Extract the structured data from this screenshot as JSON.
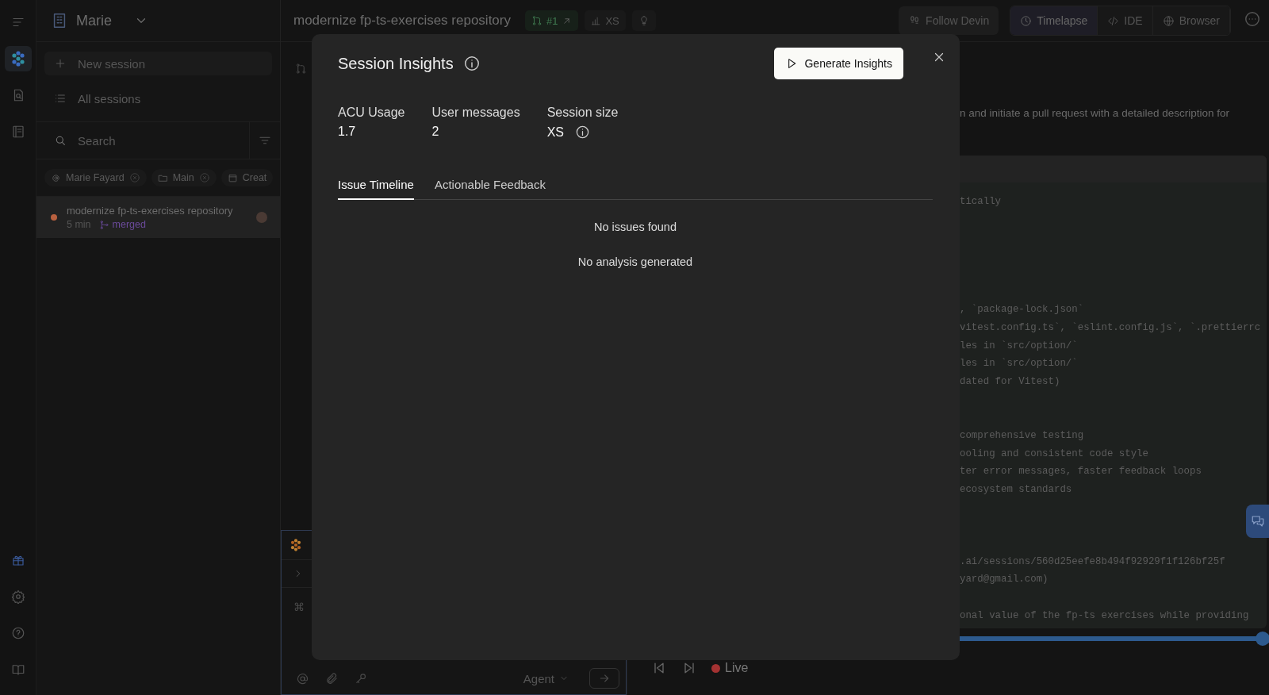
{
  "rail": {
    "top_icons": [
      {
        "kind": "menu",
        "selected": false
      },
      {
        "kind": "logo",
        "selected": true
      },
      {
        "kind": "doc-search",
        "selected": false
      },
      {
        "kind": "notebook",
        "selected": false
      }
    ],
    "bottom_icons": [
      {
        "kind": "gift"
      },
      {
        "kind": "gear"
      },
      {
        "kind": "help"
      },
      {
        "kind": "book"
      }
    ]
  },
  "sidebar": {
    "workspace": "Marie",
    "new_session": "New session",
    "all_sessions": "All sessions",
    "search": {
      "placeholder": "Search"
    },
    "filters": [
      {
        "label": "Marie Fayard",
        "kind": "user",
        "removable": true
      },
      {
        "label": "Main",
        "kind": "folder",
        "removable": true
      },
      {
        "label": "Creat",
        "kind": "date",
        "removable": false
      }
    ],
    "sessions": [
      {
        "title": "modernize fp-ts-exercises repository",
        "time": "5 min",
        "status": "merged",
        "selected": true,
        "color": "#b8603f"
      }
    ]
  },
  "topbar": {
    "title": "modernize fp-ts-exercises repository",
    "chips": [
      {
        "kind": "pr",
        "label": "#1"
      },
      {
        "kind": "size",
        "label": "XS"
      },
      {
        "kind": "idea"
      }
    ],
    "follow": "Follow Devin",
    "views": [
      {
        "label": "Timelapse",
        "kind": "clock",
        "selected": true
      },
      {
        "label": "IDE",
        "kind": "code",
        "selected": false
      },
      {
        "label": "Browser",
        "kind": "globe",
        "selected": false
      }
    ]
  },
  "chat": {
    "composer": {
      "placeholder": "⌘",
      "mode": "Agent"
    }
  },
  "timelapse": {
    "description": "n and initiate a pull request with a detailed description for",
    "code_lines": [
      {
        "kind": "code",
        "text": "tically"
      },
      {
        "kind": "blank"
      },
      {
        "kind": "blank"
      },
      {
        "kind": "blank"
      },
      {
        "kind": "blank"
      },
      {
        "kind": "blank"
      },
      {
        "kind": "code",
        "text": ", `package-lock.json`"
      },
      {
        "kind": "code",
        "text": "vitest.config.ts`, `eslint.config.js`, `.prettierrc"
      },
      {
        "kind": "code",
        "text": "les in `src/option/`"
      },
      {
        "kind": "code",
        "text": "les in `src/option/`"
      },
      {
        "kind": "code",
        "text": "dated for Vitest)"
      },
      {
        "kind": "blank"
      },
      {
        "kind": "blank"
      },
      {
        "kind": "code",
        "text": "comprehensive testing"
      },
      {
        "kind": "code",
        "text": "ooling and consistent code style"
      },
      {
        "kind": "code",
        "text": "ter error messages, faster feedback loops"
      },
      {
        "kind": "code",
        "text": "ecosystem standards"
      },
      {
        "kind": "blank"
      },
      {
        "kind": "blank"
      },
      {
        "kind": "blank"
      },
      {
        "kind": "code",
        "text": ".ai/sessions/560d25eefe8b494f92929f1f126bf25f"
      },
      {
        "kind": "code",
        "text": "yard@gmail.com)"
      },
      {
        "kind": "blank"
      },
      {
        "kind": "code",
        "text": "onal value of the fp-ts exercises while providing"
      }
    ],
    "playback": {
      "level": 1,
      "live": "Live"
    }
  },
  "modal": {
    "title": "Session Insights",
    "action": "Generate Insights",
    "stats": [
      {
        "label": "ACU Usage",
        "value": "1.7",
        "info": false
      },
      {
        "label": "User messages",
        "value": "2",
        "info": false
      },
      {
        "label": "Session size",
        "value": "XS",
        "info": true
      }
    ],
    "tabs": [
      {
        "label": "Issue Timeline",
        "selected": true
      },
      {
        "label": "Actionable Feedback",
        "selected": false
      }
    ],
    "messages": [
      "No issues found",
      "No analysis generated"
    ]
  }
}
